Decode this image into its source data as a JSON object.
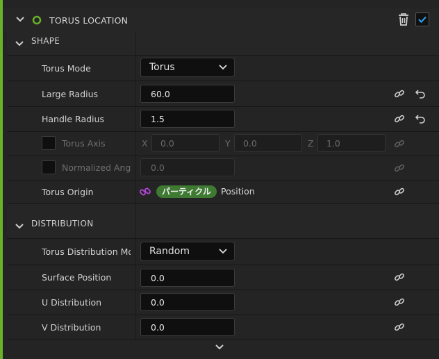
{
  "module": {
    "title": "TORUS LOCATION",
    "accent_color": "#6ab02a",
    "enabled": true
  },
  "sections": {
    "shape": {
      "label": "SHAPE"
    },
    "distribution": {
      "label": "DISTRIBUTION"
    }
  },
  "shape": {
    "torus_mode": {
      "label": "Torus Mode",
      "value": "Torus"
    },
    "large_radius": {
      "label": "Large Radius",
      "value": "60.0"
    },
    "handle_radius": {
      "label": "Handle Radius",
      "value": "1.5"
    },
    "torus_axis": {
      "label": "Torus Axis",
      "enabled": false,
      "x_label": "X",
      "x": "0.0",
      "y_label": "Y",
      "y": "0.0",
      "z_label": "Z",
      "z": "1.0"
    },
    "normalized_angle": {
      "label": "Normalized Angle",
      "enabled": false,
      "value": "0.0"
    },
    "torus_origin": {
      "label": "Torus Origin",
      "namespace_pill": "パーティクル",
      "attribute": "Position",
      "pill_color": "#3e7a32"
    }
  },
  "distribution": {
    "mode": {
      "label": "Torus Distribution Mode",
      "value": "Random"
    },
    "surface_position": {
      "label": "Surface Position",
      "value": "0.0"
    },
    "u_distribution": {
      "label": "U Distribution",
      "value": "0.0"
    },
    "v_distribution": {
      "label": "V Distribution",
      "value": "0.0"
    }
  },
  "icons": {
    "expand": "chevron-down-icon",
    "link": "link-icon",
    "reset": "reset-arrow-icon",
    "delete": "trash-icon",
    "status": "status-ring-icon"
  }
}
